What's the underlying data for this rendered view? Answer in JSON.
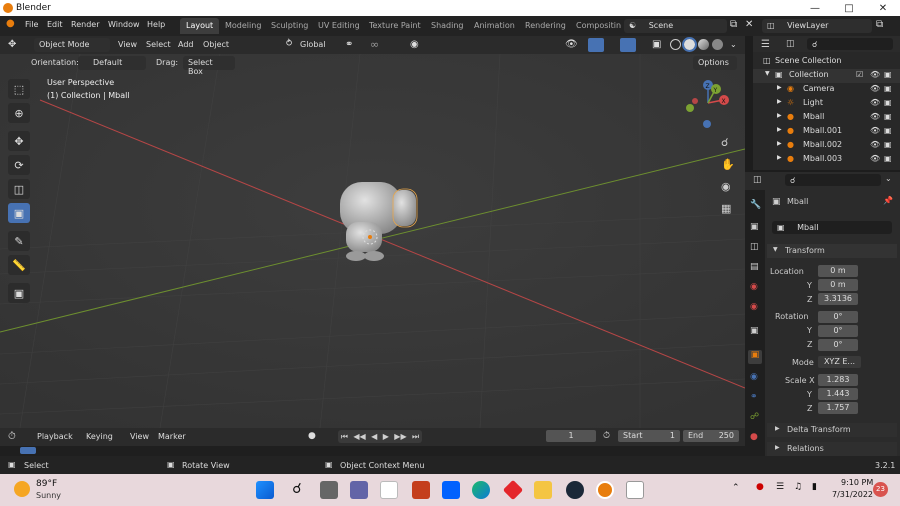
{
  "window": {
    "title": "Blender"
  },
  "menu": [
    "File",
    "Edit",
    "Render",
    "Window",
    "Help"
  ],
  "workspaces": [
    "Layout",
    "Modeling",
    "Sculpting",
    "UV Editing",
    "Texture Paint",
    "Shading",
    "Animation",
    "Rendering",
    "Compositin"
  ],
  "scene": {
    "label": "Scene",
    "view_layer": "ViewLayer"
  },
  "viewport_header": {
    "mode": "Object Mode",
    "menus": [
      "View",
      "Select",
      "Add",
      "Object"
    ],
    "transform": "Global",
    "orientation_label": "Orientation:",
    "orientation_value": "Default",
    "drag_label": "Drag:",
    "drag_value": "Select Box",
    "options": "Options"
  },
  "viewport": {
    "perspective": "User Perspective",
    "collection_info": "(1) Collection | Mball",
    "axes": {
      "x": "X",
      "y": "Y",
      "z": "Z"
    }
  },
  "outliner": {
    "root": "Scene Collection",
    "collection": "Collection",
    "items": [
      "Camera",
      "Light",
      "Mball",
      "Mball.001",
      "Mball.002",
      "Mball.003"
    ]
  },
  "properties": {
    "object_name": "Mball",
    "data_name": "Mball",
    "transform_title": "Transform",
    "location_label": "Location",
    "location": {
      "x": "0 m",
      "y": "0 m",
      "z": "3.3136"
    },
    "rotation_label": "Rotation",
    "rotation": {
      "x": "0°",
      "y": "0°",
      "z": "0°"
    },
    "mode_label": "Mode",
    "mode_value": "XYZ E...",
    "scale_label": "Scale X",
    "scale": {
      "x": "1.283",
      "y": "1.443",
      "z": "1.757"
    },
    "axis_y": "Y",
    "axis_z": "Z",
    "delta_transform": "Delta Transform",
    "relations": "Relations"
  },
  "timeline": {
    "menus": [
      "Playback",
      "Keying",
      "View",
      "Marker"
    ],
    "current_frame": "1",
    "start_label": "Start",
    "start": "1",
    "end_label": "End",
    "end": "250"
  },
  "statusbar": {
    "select": "Select",
    "rotate": "Rotate View",
    "context": "Object Context Menu",
    "version": "3.2.1"
  },
  "taskbar": {
    "weather_temp": "89°F",
    "weather_desc": "Sunny",
    "time": "9:10 PM",
    "date": "7/31/2022",
    "badge": "23"
  },
  "colors": {
    "accent": "#4772b3",
    "orange": "#e87d0d",
    "x_axis": "#d44a4a",
    "y_axis": "#7ca232"
  }
}
